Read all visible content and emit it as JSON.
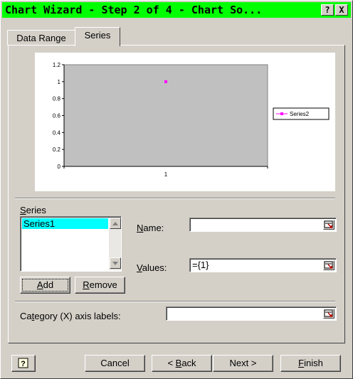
{
  "window": {
    "title": "Chart Wizard - Step 2 of 4 - Chart So...",
    "help_btn": "?",
    "close_btn": "X"
  },
  "tabs": [
    {
      "label": "Data Range",
      "selected": false
    },
    {
      "label": "Series",
      "selected": true
    }
  ],
  "chart_data": {
    "type": "line",
    "categories": [
      "1"
    ],
    "yticks": [
      "1.2",
      "1",
      "0.8",
      "0.6",
      "0.4",
      "0.2",
      "0"
    ],
    "ylim": [
      0,
      1.2
    ],
    "series": [
      {
        "name": "Series2",
        "values": [
          1
        ],
        "color": "#ff00ff"
      }
    ],
    "legend": "right"
  },
  "series_section": {
    "group_label": "Series",
    "items": [
      "Series1"
    ],
    "name_label": "Name:",
    "name_value": "",
    "values_label": "Values:",
    "values_value": "={1}",
    "add_label": "Add",
    "remove_label": "Remove"
  },
  "category": {
    "label": "Category (X) axis labels:",
    "value": ""
  },
  "footer": {
    "cancel": "Cancel",
    "back": "< Back",
    "next": "Next >",
    "finish": "Finish"
  }
}
